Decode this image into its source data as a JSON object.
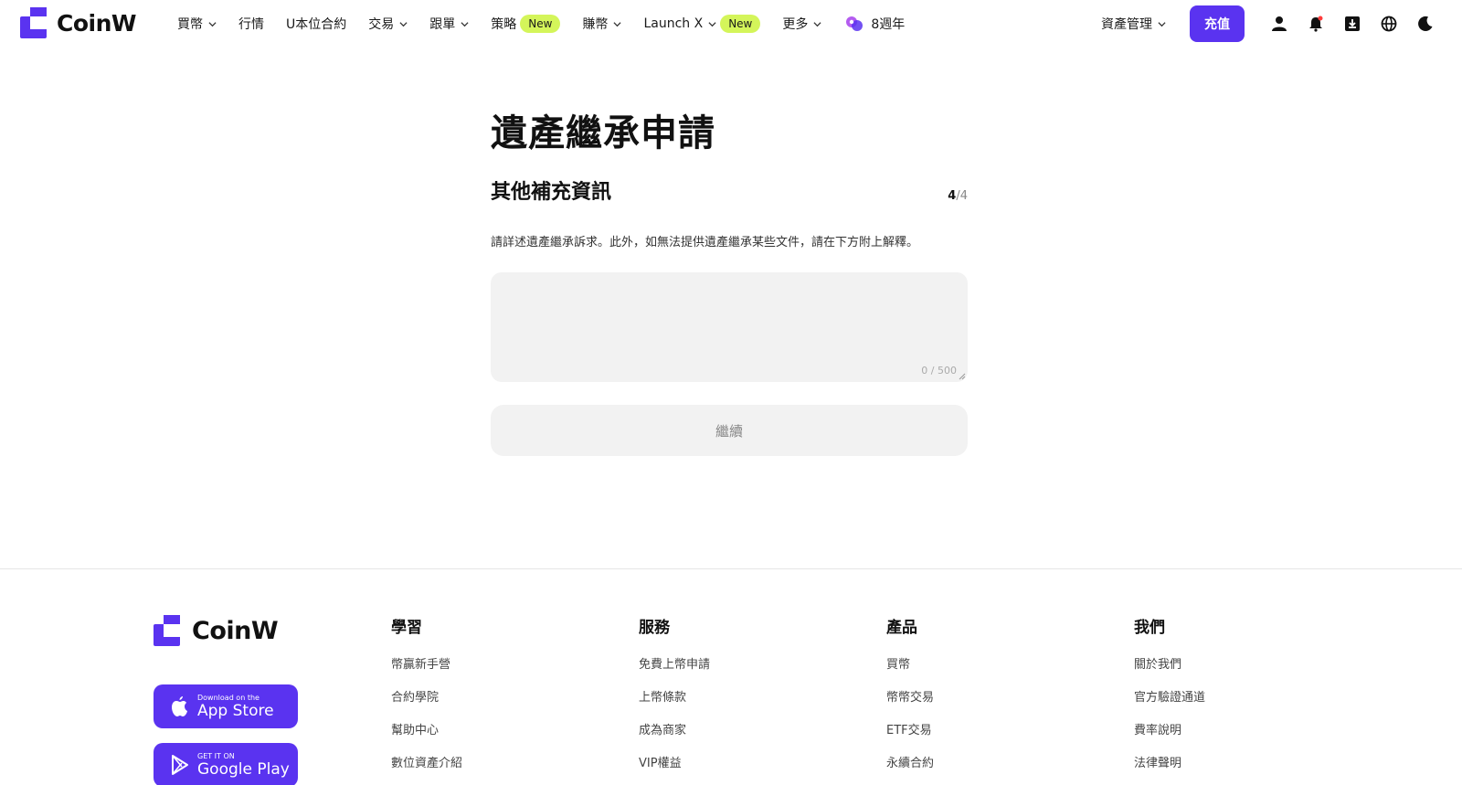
{
  "brand": {
    "name": "CoinW",
    "color": "#5a33f0"
  },
  "nav": {
    "items": [
      {
        "label": "買幣",
        "dropdown": true
      },
      {
        "label": "行情",
        "dropdown": false
      },
      {
        "label": "U本位合約",
        "dropdown": false
      },
      {
        "label": "交易",
        "dropdown": true
      },
      {
        "label": "跟單",
        "dropdown": true
      },
      {
        "label": "策略",
        "badge": "New"
      },
      {
        "label": "賺幣",
        "dropdown": true
      },
      {
        "label": "Launch X",
        "dropdown": true,
        "badge": "New"
      },
      {
        "label": "更多",
        "dropdown": true
      },
      {
        "label": "8週年",
        "icon": "anniversary-icon"
      }
    ]
  },
  "header": {
    "asset_management": "資產管理",
    "deposit": "充值",
    "icons": [
      "user-icon",
      "bell-icon",
      "download-icon",
      "globe-icon",
      "moon-icon"
    ],
    "notification_dot_color": "#ff3b3b"
  },
  "form": {
    "title": "遺產繼承申請",
    "section_title": "其他補充資訊",
    "step_current": "4",
    "step_total": "/4",
    "description": "請詳述遺產繼承訴求。此外，如無法提供遺產繼承某些文件，請在下方附上解釋。",
    "textarea_value": "",
    "counter": "0 / 500",
    "continue_label": "繼續"
  },
  "footer": {
    "brand": "CoinW",
    "app_store": {
      "small": "Download on the",
      "big": "App Store"
    },
    "google_play": {
      "small": "GET IT ON",
      "big": "Google Play"
    },
    "columns": [
      {
        "title": "學習",
        "links": [
          "幣贏新手營",
          "合約學院",
          "幫助中心",
          "數位資產介紹"
        ]
      },
      {
        "title": "服務",
        "links": [
          "免費上幣申請",
          "上幣條款",
          "成為商家",
          "VIP權益"
        ]
      },
      {
        "title": "產品",
        "links": [
          "買幣",
          "幣幣交易",
          "ETF交易",
          "永續合約"
        ]
      },
      {
        "title": "我們",
        "links": [
          "關於我們",
          "官方驗證通道",
          "費率說明",
          "法律聲明"
        ]
      }
    ]
  }
}
